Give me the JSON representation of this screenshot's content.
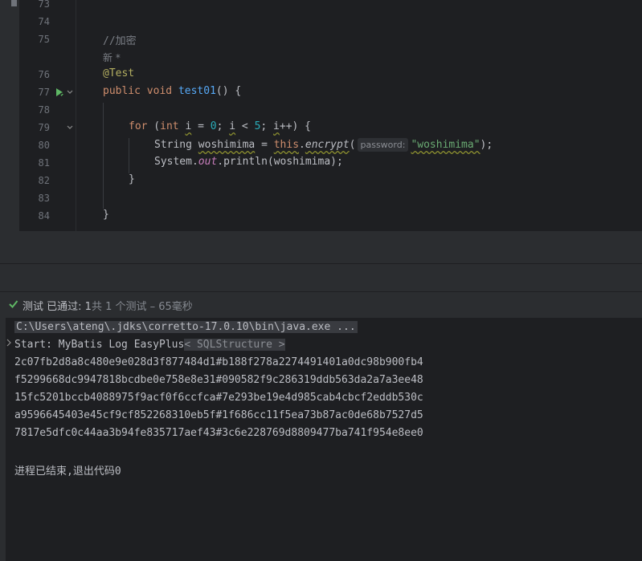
{
  "editor": {
    "line_numbers": [
      "73",
      "74",
      "75",
      "76",
      "77",
      "78",
      "79",
      "80",
      "81",
      "82",
      "83",
      "84"
    ],
    "lines": {
      "l75_comment": "//加密",
      "l_new": "新 *",
      "l76_annotation": "@Test",
      "l77_public": "public",
      "l77_void": "void",
      "l77_name": "test01",
      "l77_rest": "() {",
      "l79_for": "for",
      "l79_open": " (",
      "l79_int": "int",
      "l79_i1": "i",
      "l79_eq": " = ",
      "l79_zero": "0",
      "l79_semi1": "; ",
      "l79_i2": "i",
      "l79_lt": " < ",
      "l79_five": "5",
      "l79_semi2": "; ",
      "l79_i3": "i",
      "l79_end": "++) {",
      "l80_type": "String ",
      "l80_var": "woshimima",
      "l80_eq": " = ",
      "l80_this": "this",
      "l80_dot": ".",
      "l80_method": "encrypt",
      "l80_paren": "(",
      "l80_hint": "password:",
      "l80_str": "\"woshimima\"",
      "l80_end": ");",
      "l81_sys": "System.",
      "l81_out": "out",
      "l81_rest": ".println(woshimima);",
      "l82_close": "}",
      "l84_close": "}"
    }
  },
  "status": {
    "label": "测试 已通过: ",
    "passed": "1",
    "summary": "共 1 个测试 – 65毫秒"
  },
  "console": {
    "command": "C:\\Users\\ateng\\.jdks\\corretto-17.0.10\\bin\\java.exe ...",
    "start_prefix": "Start: MyBatis Log EasyPlus",
    "start_tag": "< SQLStructure >",
    "hashes": [
      "2c07fb2d8a8c480e9e028d3f877484d1#b188f278a2274491401a0dc98b900fb4",
      "f5299668dc9947818bcdbe0e758e8e31#090582f9c286319ddb563da2a7a3ee48",
      "15fc5201bccb4088975f9acf0f6ccfca#7e293be19e4d985cab4cbcf2eddb530c",
      "a9596645403e45cf9cf852268310eb5f#1f686cc11f5ea73b87ac0de68b7527d5",
      "7817e5dfc0c44aa3b94fe835717aef43#3c6e228769d8809477ba741f954e8ee0"
    ],
    "exit": "进程已结束,退出代码0"
  },
  "colors": {
    "background": "#1e1f22",
    "panel": "#2b2d30",
    "keyword": "#cf8e6d",
    "function": "#56a8f5",
    "string": "#6aab73",
    "number": "#2aacb8",
    "success": "#5fb865"
  },
  "icons": {
    "run": "run-test-icon",
    "fold": "fold-chevron-icon",
    "check": "check-icon",
    "expand": "expand-chevron-icon"
  }
}
